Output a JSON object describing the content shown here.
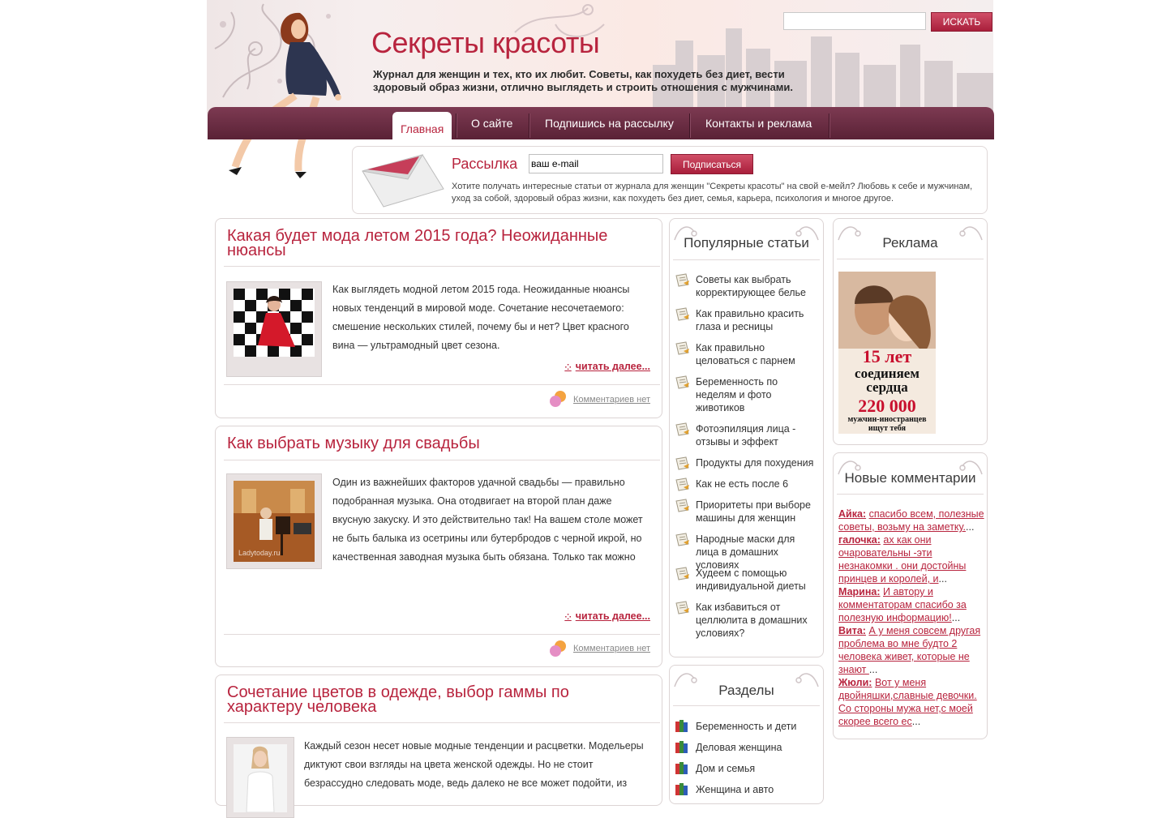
{
  "header": {
    "site_title": "Секреты красоты",
    "tagline": "Журнал для женщин и тех, кто их любит. Советы, как похудеть без диет, вести здоровый образ жизни, отлично выглядеть и строить отношения с мужчинами.",
    "search_placeholder": "",
    "search_button": "ИСКАТЬ"
  },
  "nav": {
    "items": [
      {
        "label": "Главная",
        "active": true
      },
      {
        "label": "О сайте"
      },
      {
        "label": "Подпишись на рассылку"
      },
      {
        "label": "Контакты и реклама"
      }
    ]
  },
  "newsletter": {
    "title": "Рассылка",
    "email_value": "ваш e-mail",
    "button": "Подписаться",
    "description": "Хотите получать интересные статьи от журнала для женщин \"Секреты красоты\" на свой е-мейл? Любовь к себе и мужчинам, уход за собой, здоровый образ жизни, как похудеть без диет, семья, карьера, психология и многое другое."
  },
  "articles": [
    {
      "title": "Какая будет мода летом 2015 года? Неожиданные нюансы",
      "excerpt": "Как выглядеть модной летом 2015 года. Неожиданные нюансы новых тенденций в мировой моде. Сочетание несочетаемого: смешение нескольких стилей, почему бы и нет? Цвет красного вина — ультрамодный цвет сезона.",
      "read_more": "читать далее...",
      "comments": "Комментариев нет"
    },
    {
      "title": "Как выбрать музыку для свадьбы",
      "excerpt": "Один из важнейших факторов удачной свадьбы — правильно подобранная музыка. Она отодвигает на второй план даже вкусную закуску. И это действительно так! На вашем столе может не быть балыка из осетрины или бутербродов с черной икрой, но качественная заводная музыка быть обязана. Только так можно обеспечить всеобщее веселье. А это ведь — главная цель торжества!",
      "watermark": "Ladytoday.ru",
      "read_more": "читать далее...",
      "comments": "Комментариев нет"
    },
    {
      "title": "Сочетание цветов в одежде, выбор гаммы по характеру человека",
      "excerpt": "Каждый сезон несет новые модные тенденции и расцветки. Модельеры диктуют свои взгляды на цвета женской одежды. Но не стоит безрассудно следовать моде, ведь далеко не все может подойти, из"
    }
  ],
  "popular": {
    "title": "Популярные статьи",
    "items": [
      "Советы как выбрать корректирующее белье",
      "Как правильно красить глаза и ресницы",
      "Как правильно целоваться с парнем",
      "Беременность по неделям и фото животиков",
      "Фотоэпиляция лица - отзывы и эффект",
      "Продукты для похудения",
      "Как не есть после 6",
      "Приоритеты при выборе машины для женщин",
      "Народные маски для лица в домашних условиях",
      "Худеем с помощью индивидуальной диеты",
      "Как избавиться от целлюлита в домашних условиях?"
    ]
  },
  "sections": {
    "title": "Разделы",
    "items": [
      "Беременность и дети",
      "Деловая женщина",
      "Дом и семья",
      "Женщина и авто"
    ]
  },
  "ads": {
    "title": "Реклама",
    "banner_line1": "15 лет",
    "banner_line2": "соединяем",
    "banner_line3": "сердца",
    "banner_line4": "220 000",
    "banner_line5": "мужчин-иностранцев",
    "banner_line6": "ищут тебя"
  },
  "new_comments": {
    "title": "Новые комментарии",
    "items": [
      {
        "author": "Айка:",
        "text": "спасибо всем, полезные советы, возьму на заметку."
      },
      {
        "author": "галочка:",
        "text": "ах как они очаровательны -эти незнакомки . они достойны принцев и королей, и"
      },
      {
        "author": "Марина:",
        "text": "И автору и комментаторам спасибо за полезную информацию!"
      },
      {
        "author": "Вита:",
        "text": "А у меня совсем другая проблема во мне будто 2 человека живет, которые не знают "
      },
      {
        "author": "Жюли:",
        "text": "Вот у меня двойняшки,славные девочки. Со стороны мужа нет,с моей скорее всего ес"
      }
    ]
  },
  "colors": {
    "accent": "#b8243e",
    "nav": "#6b2b42"
  }
}
